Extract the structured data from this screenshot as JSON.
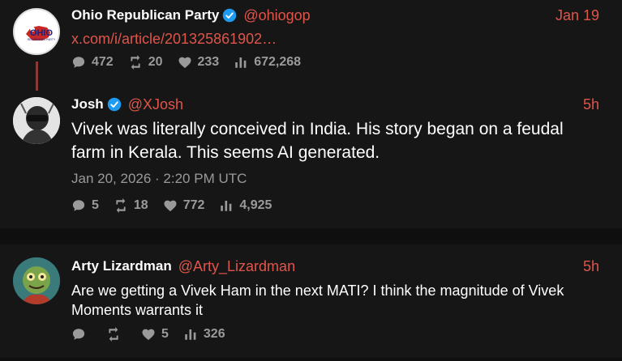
{
  "tweets": [
    {
      "name": "Ohio Republican Party",
      "handle": "@ohiogop",
      "time": "Jan 19",
      "link": "x.com/i/article/201325861902…",
      "avatar_label": "OHIO",
      "avatar_sub": "REPUBLICAN PARTY",
      "stats": {
        "replies": "472",
        "retweets": "20",
        "likes": "233",
        "views": "672,268"
      }
    },
    {
      "name": "Josh",
      "handle": "@XJosh",
      "time": "5h",
      "text": "Vivek was literally conceived in India. His story began on a feudal farm in Kerala. This seems AI generated.",
      "date": "Jan 20, 2026 · 2:20 PM UTC",
      "stats": {
        "replies": "5",
        "retweets": "18",
        "likes": "772",
        "views": "4,925"
      }
    },
    {
      "name": "Arty Lizardman",
      "handle": "@Arty_Lizardman",
      "time": "5h",
      "text": "Are we getting a Vivek Ham in the next MATI? I think the magnitude of Vivek Moments warrants it",
      "stats": {
        "replies": "",
        "retweets": "",
        "likes": "5",
        "views": "326"
      }
    }
  ],
  "colors": {
    "accent": "#e0554a",
    "muted": "#9a9a9a",
    "verified": "#1d9bf0",
    "background": "#0f0f0f",
    "card": "#161616"
  }
}
